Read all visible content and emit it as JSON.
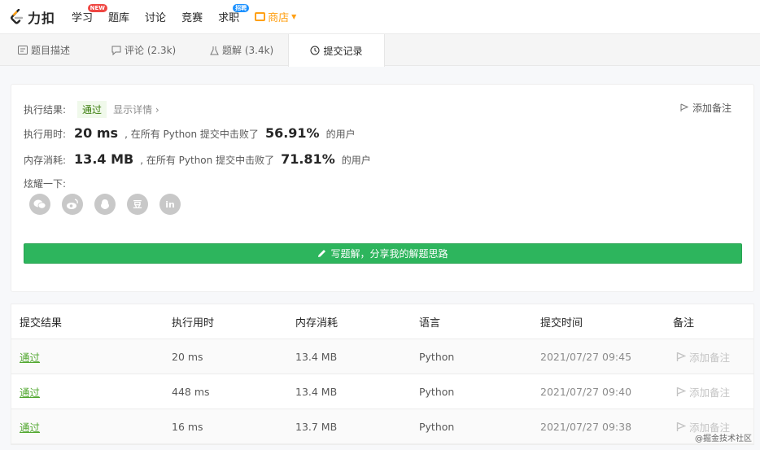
{
  "nav": {
    "logo": "力扣",
    "items": [
      {
        "label": "学习",
        "badge": "NEW"
      },
      {
        "label": "题库"
      },
      {
        "label": "讨论"
      },
      {
        "label": "竞赛"
      },
      {
        "label": "求职",
        "badge": "招聘"
      },
      {
        "label": "商店"
      }
    ]
  },
  "tabs": [
    {
      "label": "题目描述",
      "icon": "document-icon"
    },
    {
      "label": "评论 (2.3k)",
      "icon": "comment-icon"
    },
    {
      "label": "题解 (3.4k)",
      "icon": "flask-icon"
    },
    {
      "label": "提交记录",
      "icon": "clock-icon",
      "active": true
    }
  ],
  "result": {
    "label_result": "执行结果:",
    "status": "通过",
    "detail": "显示详情 ›",
    "add_note": "添加备注",
    "label_time": "执行用时:",
    "runtime": "20 ms",
    "runtime_text": ", 在所有 Python 提交中击败了",
    "runtime_pct": "56.91%",
    "users": "的用户",
    "label_memory": "内存消耗:",
    "memory": "13.4 MB",
    "memory_text": ", 在所有 Python 提交中击败了",
    "memory_pct": "71.81%",
    "share_label": "炫耀一下:",
    "share_icons": [
      "wechat-icon",
      "weibo-icon",
      "qq-icon",
      "douban-icon",
      "linkedin-icon"
    ],
    "douban_glyph": "豆",
    "linkedin_glyph": "in",
    "write_button": "写题解，分享我的解题思路"
  },
  "table": {
    "headers": [
      "提交结果",
      "执行用时",
      "内存消耗",
      "语言",
      "提交时间",
      "备注"
    ],
    "rows": [
      {
        "status": "通过",
        "runtime": "20 ms",
        "memory": "13.4 MB",
        "language": "Python",
        "time": "2021/07/27 09:45",
        "remark": "添加备注"
      },
      {
        "status": "通过",
        "runtime": "448 ms",
        "memory": "13.4 MB",
        "language": "Python",
        "time": "2021/07/27 09:40",
        "remark": "添加备注"
      },
      {
        "status": "通过",
        "runtime": "16 ms",
        "memory": "13.7 MB",
        "language": "Python",
        "time": "2021/07/27 09:38",
        "remark": "添加备注"
      }
    ]
  },
  "watermark": "@掘金技术社区",
  "colors": {
    "accent": "#ffa116",
    "success": "#2db55d",
    "pass_text": "#52a830"
  }
}
